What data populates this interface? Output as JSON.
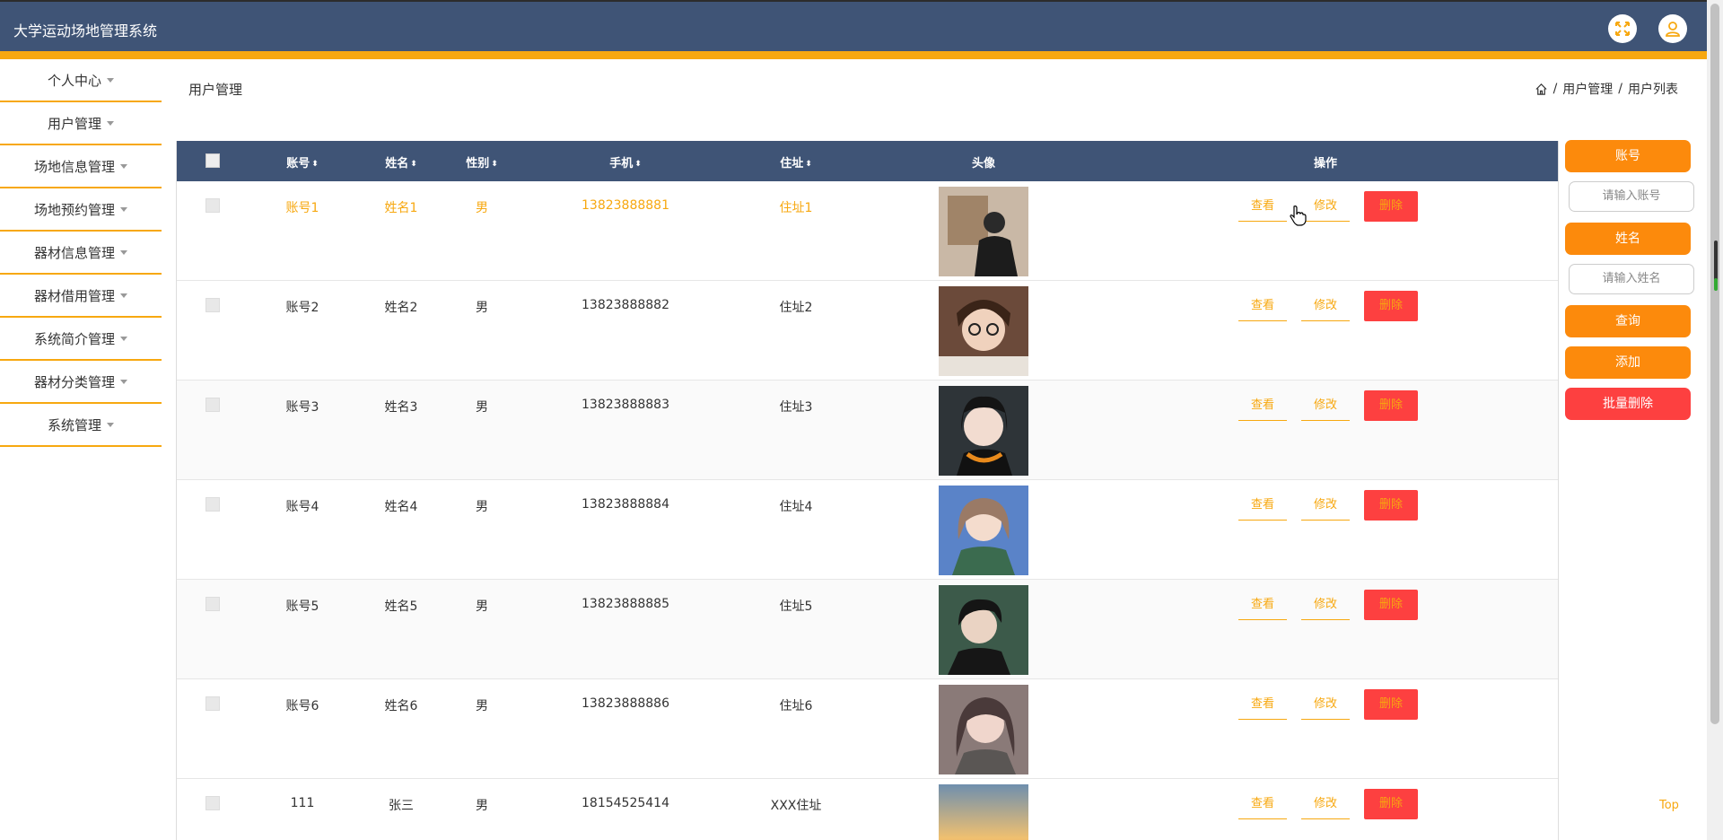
{
  "app": {
    "title": "大学运动场地管理系统"
  },
  "topbar": {
    "fullscreen_icon": "fullscreen-icon",
    "user_icon": "user-icon"
  },
  "sidebar": {
    "items": [
      {
        "label": "个人中心"
      },
      {
        "label": "用户管理"
      },
      {
        "label": "场地信息管理"
      },
      {
        "label": "场地预约管理"
      },
      {
        "label": "器材信息管理"
      },
      {
        "label": "器材借用管理"
      },
      {
        "label": "系统简介管理"
      },
      {
        "label": "器材分类管理"
      },
      {
        "label": "系统管理"
      }
    ]
  },
  "page": {
    "title": "用户管理"
  },
  "breadcrumb": {
    "level1": "用户管理",
    "sep": "/",
    "level2": "用户列表"
  },
  "table": {
    "headers": {
      "account": "账号",
      "name": "姓名",
      "gender": "性别",
      "phone": "手机",
      "address": "住址",
      "avatar": "头像",
      "actions": "操作"
    },
    "actions": {
      "view": "查看",
      "edit": "修改",
      "delete": "删除"
    },
    "rows": [
      {
        "account": "账号1",
        "name": "姓名1",
        "gender": "男",
        "phone": "13823888881",
        "address": "住址1"
      },
      {
        "account": "账号2",
        "name": "姓名2",
        "gender": "男",
        "phone": "13823888882",
        "address": "住址2"
      },
      {
        "account": "账号3",
        "name": "姓名3",
        "gender": "男",
        "phone": "13823888883",
        "address": "住址3"
      },
      {
        "account": "账号4",
        "name": "姓名4",
        "gender": "男",
        "phone": "13823888884",
        "address": "住址4"
      },
      {
        "account": "账号5",
        "name": "姓名5",
        "gender": "男",
        "phone": "13823888885",
        "address": "住址5"
      },
      {
        "account": "账号6",
        "name": "姓名6",
        "gender": "男",
        "phone": "13823888886",
        "address": "住址6"
      },
      {
        "account": "111",
        "name": "张三",
        "gender": "男",
        "phone": "18154525414",
        "address": "XXX住址"
      }
    ]
  },
  "search": {
    "account_label": "账号",
    "account_placeholder": "请输入账号",
    "name_label": "姓名",
    "name_placeholder": "请输入姓名",
    "query": "查询",
    "add": "添加",
    "batch_delete": "批量删除"
  },
  "footer": {
    "top_link": "Top"
  },
  "colors": {
    "header_bg": "#3f5476",
    "accent": "#f7a810",
    "button": "#fc8a0c",
    "danger": "#fd4040"
  }
}
